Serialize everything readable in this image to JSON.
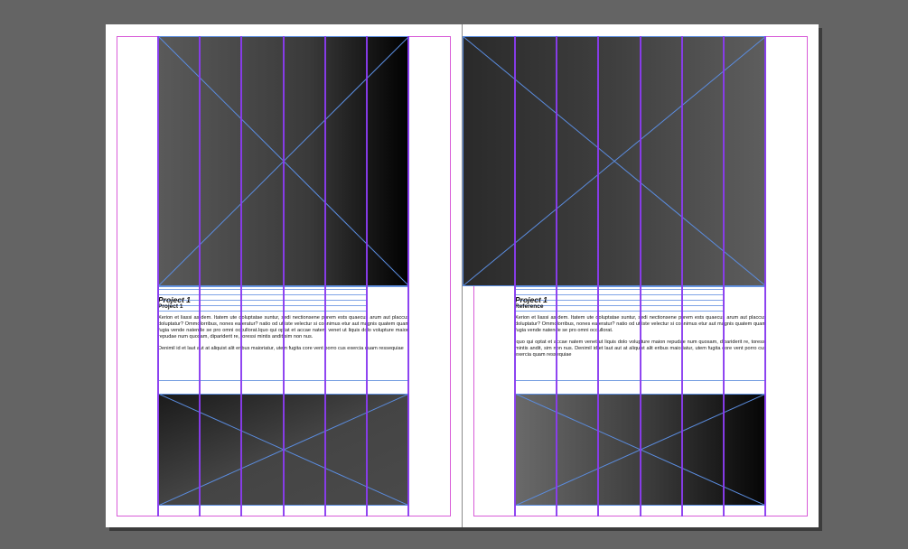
{
  "left_page": {
    "title": "Project 1",
    "subtitle": "Project 1",
    "body": [
      "Xerion et liassi as dem. Itatem ute doluptatae suntur, sedi nectionsene porem ests quaecus arum aut placcus doluptatur? Ommolorribus, nones ea eratur? natio od ut iste velectur si connimus etur aut magnis quatem quam fugia vende natende se pro omni occullorat.Iquo qui optat et accae natem venet ut liquis dolo volupture maion repudae num quosam, dipariderit re, toressi mintis andit sim non nus.",
      "Denimil id et laut aut at aliquist alit eribus maioriatur, utem fugita core vent porro cus exercia quam ressequiae"
    ]
  },
  "right_page": {
    "title": "Project 1",
    "subtitle": "Reference",
    "body": [
      "Xerion et liassi as dem. Itatem ute doluptatae suntur, sedi nectionsene porem ests quaecus arum aut placcus doluptatur? Ommolorribus, nones ea eratur? natio od ut iste velectur si connimus etur aut magnis quatem quam fugia vende natende se pro omni occullorat.",
      "Iquo qui optat et accae natem venet ut liquis dolo volupture maion repudae num quosam, dipariderit re, toressi mintis andit, sim non nus. Denimil id et laut aut at aliquist alit eribus maioriatur, utem fugita core vent porro cus exercia quam ressequiae"
    ]
  },
  "colors": {
    "pasteboard": "#646464",
    "margin_guide": "#d85cd8",
    "column_guide": "#8a3cf0",
    "frame_edge": "#5b8de0",
    "baseline_grid": "#7ea3e6"
  }
}
